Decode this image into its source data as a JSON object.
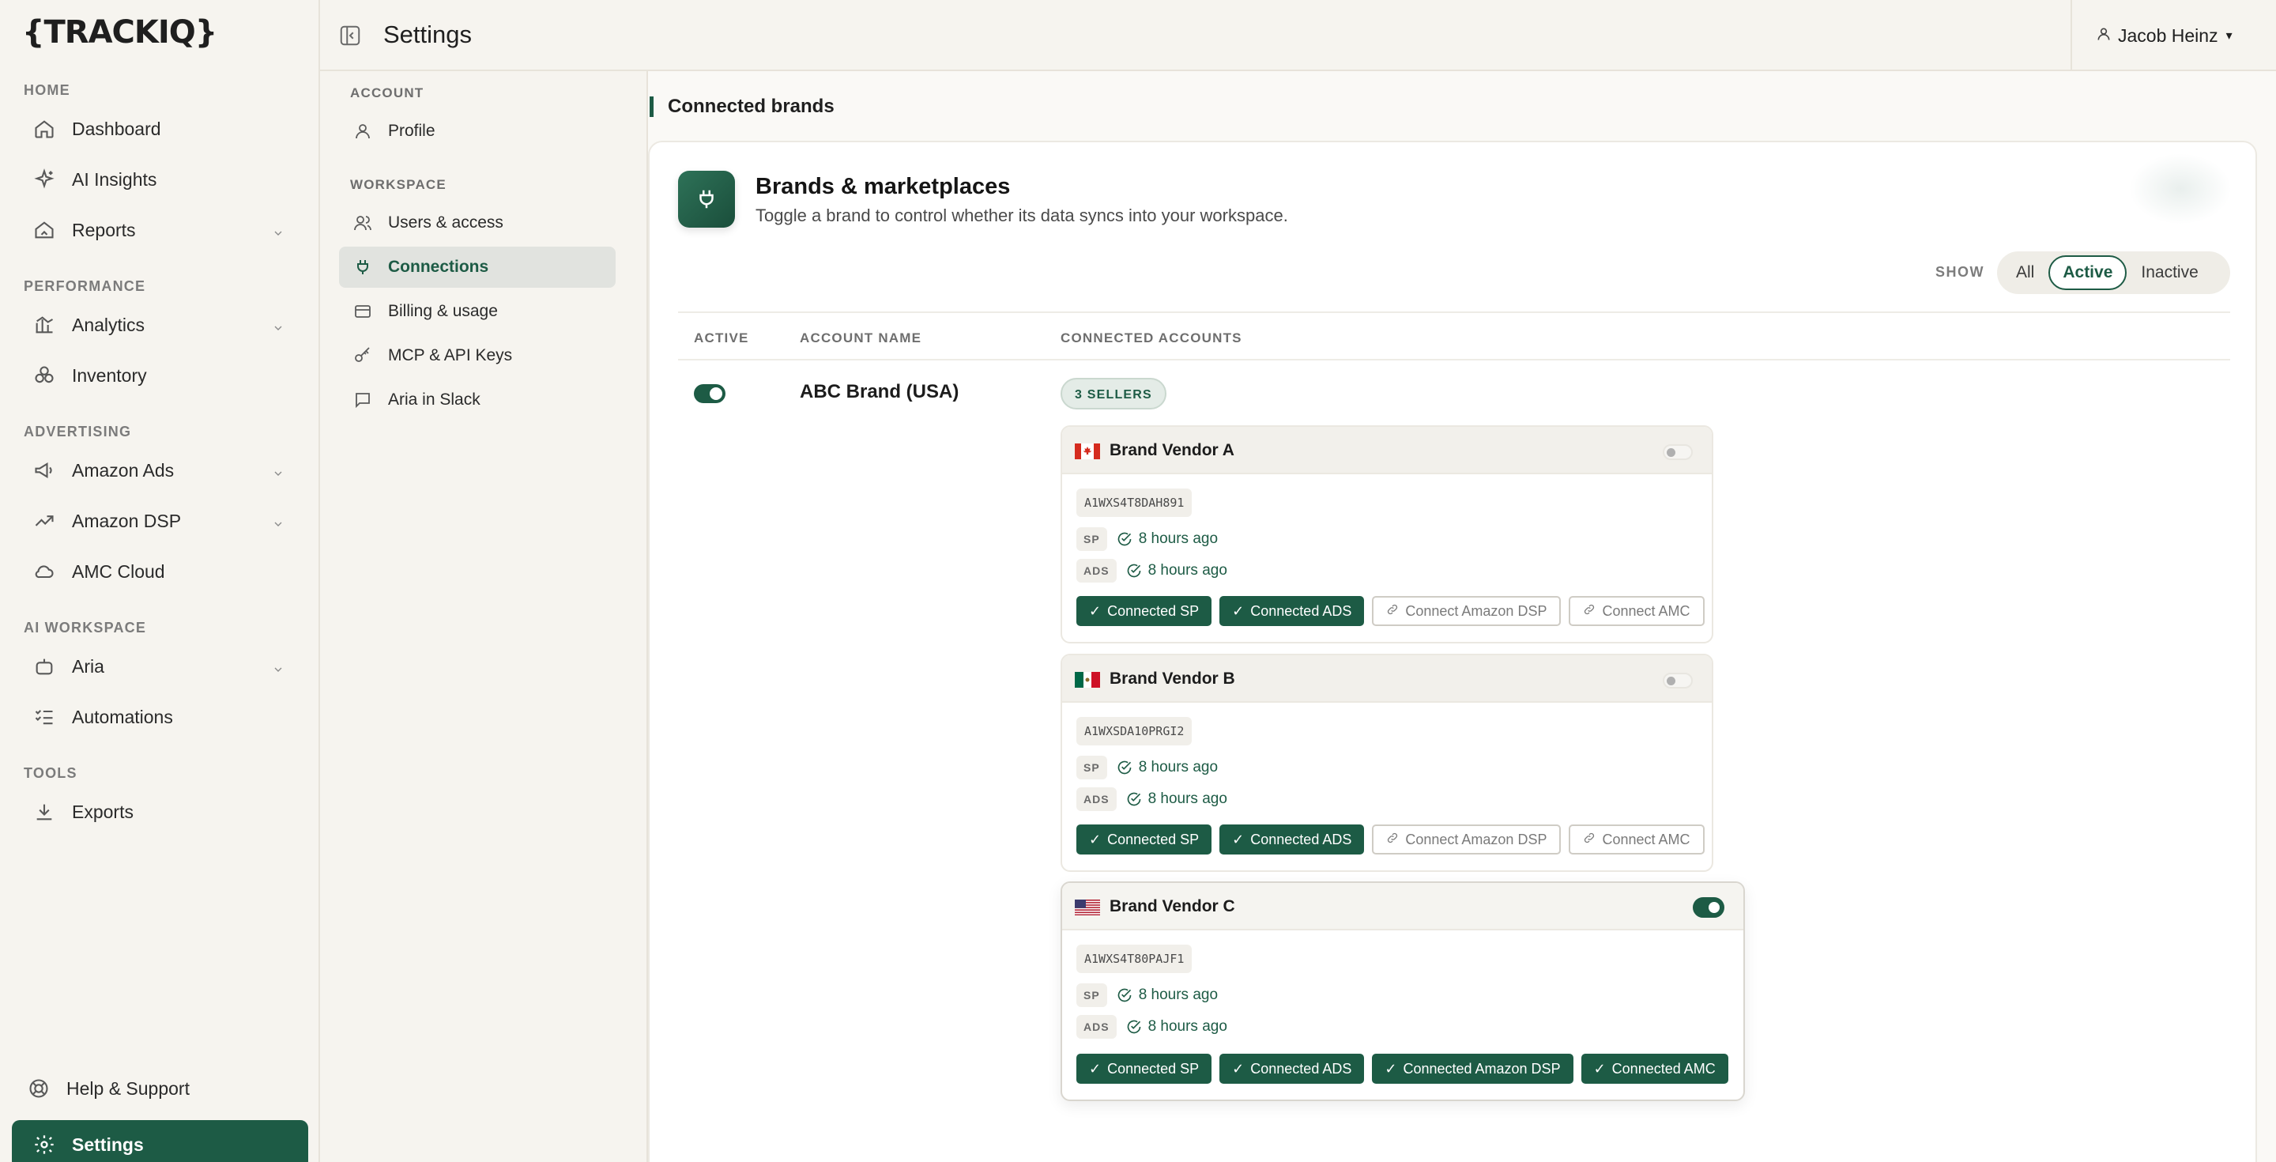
{
  "app": {
    "logo_text": "{TRACKIQ}",
    "page_title": "Settings",
    "user_name": "Jacob Heinz"
  },
  "sidebar": {
    "sections": [
      {
        "label": "HOME"
      },
      {
        "label": "PERFORMANCE"
      },
      {
        "label": "ADVERTISING"
      },
      {
        "label": "AI WORKSPACE"
      },
      {
        "label": "TOOLS"
      }
    ],
    "items": [
      {
        "label": "Dashboard",
        "icon": "home-icon"
      },
      {
        "label": "AI Insights",
        "icon": "sparkles-icon"
      },
      {
        "label": "Reports",
        "icon": "reports-icon"
      },
      {
        "label": "Analytics",
        "icon": "bar-chart-icon"
      },
      {
        "label": "Inventory",
        "icon": "boxes-icon"
      },
      {
        "label": "Amazon Ads",
        "icon": "megaphone-icon"
      },
      {
        "label": "Amazon DSP",
        "icon": "trend-icon"
      },
      {
        "label": "AMC Cloud",
        "icon": "cloud-icon"
      },
      {
        "label": "Aria",
        "icon": "robot-icon"
      },
      {
        "label": "Automations",
        "icon": "checklist-icon"
      },
      {
        "label": "Exports",
        "icon": "download-icon"
      }
    ],
    "help_label": "Help & Support",
    "settings_label": "Settings"
  },
  "subnav": {
    "account_section": "ACCOUNT",
    "workspace_section": "WORKSPACE",
    "items": [
      {
        "label": "Profile"
      },
      {
        "label": "Users & access"
      },
      {
        "label": "Connections"
      },
      {
        "label": "Billing & usage"
      },
      {
        "label": "MCP & API Keys"
      },
      {
        "label": "Aria in Slack"
      }
    ]
  },
  "main": {
    "section_title": "Connected brands",
    "card_title": "Brands & marketplaces",
    "card_subtitle": "Toggle a brand to control whether its data syncs into your workspace.",
    "show_label": "SHOW",
    "filters": [
      "All",
      "Active",
      "Inactive"
    ],
    "selected_filter": "Active",
    "columns": [
      "ACTIVE",
      "ACCOUNT NAME",
      "CONNECTED ACCOUNTS"
    ],
    "row": {
      "account_name": "ABC Brand (USA)",
      "active": true,
      "sellers_badge": "3 SELLERS"
    },
    "vendors": [
      {
        "name": "Brand Vendor A",
        "flag": "canada-flag",
        "enabled": false,
        "id": "A1WXS4T8DAH891",
        "sp_tag": "SP",
        "sp_time": "8 hours ago",
        "ads_tag": "ADS",
        "ads_time": "8 hours ago",
        "buttons": [
          {
            "label": "Connected SP",
            "connected": true
          },
          {
            "label": "Connected ADS",
            "connected": true
          },
          {
            "label": "Connect Amazon DSP",
            "connected": false
          },
          {
            "label": "Connect AMC",
            "connected": false
          }
        ]
      },
      {
        "name": "Brand Vendor B",
        "flag": "mexico-flag",
        "enabled": false,
        "id": "A1WXSDA10PRGI2",
        "sp_tag": "SP",
        "sp_time": "8 hours ago",
        "ads_tag": "ADS",
        "ads_time": "8 hours ago",
        "buttons": [
          {
            "label": "Connected SP",
            "connected": true
          },
          {
            "label": "Connected ADS",
            "connected": true
          },
          {
            "label": "Connect Amazon DSP",
            "connected": false
          },
          {
            "label": "Connect AMC",
            "connected": false
          }
        ]
      },
      {
        "name": "Brand Vendor C",
        "flag": "usa-flag",
        "enabled": true,
        "id": "A1WXS4T80PAJF1",
        "sp_tag": "SP",
        "sp_time": "8 hours ago",
        "ads_tag": "ADS",
        "ads_time": "8 hours ago",
        "buttons": [
          {
            "label": "Connected SP",
            "connected": true
          },
          {
            "label": "Connected ADS",
            "connected": true
          },
          {
            "label": "Connected Amazon DSP",
            "connected": true
          },
          {
            "label": "Connected AMC",
            "connected": true
          }
        ]
      }
    ]
  },
  "colors": {
    "accent": "#1d5b45",
    "background": "#f6f4ef",
    "card": "#ffffff"
  }
}
